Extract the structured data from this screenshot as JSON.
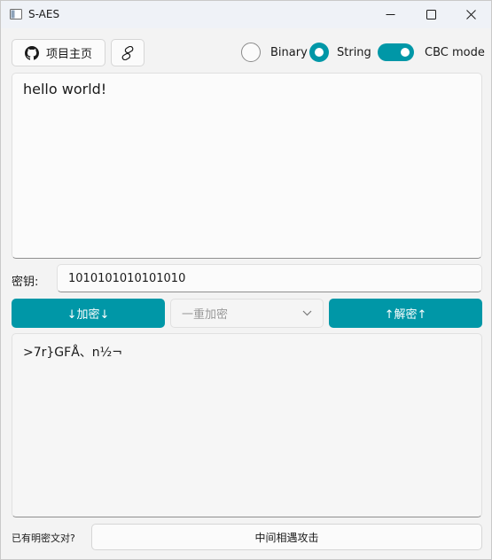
{
  "window": {
    "title": "S-AES",
    "icons": {
      "app": "window-icon",
      "minimize": "minimize-icon",
      "maximize": "maximize-icon",
      "close": "close-icon"
    }
  },
  "toolbar": {
    "home_label": "项目主页",
    "home_icon": "github-icon",
    "link_icon": "link-icon",
    "format": {
      "options": [
        "Binary",
        "String"
      ],
      "selected": "String"
    },
    "cbc": {
      "label": "CBC mode",
      "enabled": true
    }
  },
  "input": {
    "value": "hello world!"
  },
  "key": {
    "label": "密钥:",
    "value": "1010101010101010"
  },
  "actions": {
    "encrypt_label": "↓加密↓",
    "mode_value": "一重加密",
    "mode_icon": "chevron-down-icon",
    "decrypt_label": "↑解密↑"
  },
  "output": {
    "value": ">7r}GFÅ、n½¬"
  },
  "footer": {
    "question": "已有明密文对?",
    "attack_label": "中间相遇攻击"
  },
  "colors": {
    "accent": "#0097a7",
    "window_bg": "#f3f3f3",
    "titlebar_bg": "#eff2f7"
  }
}
